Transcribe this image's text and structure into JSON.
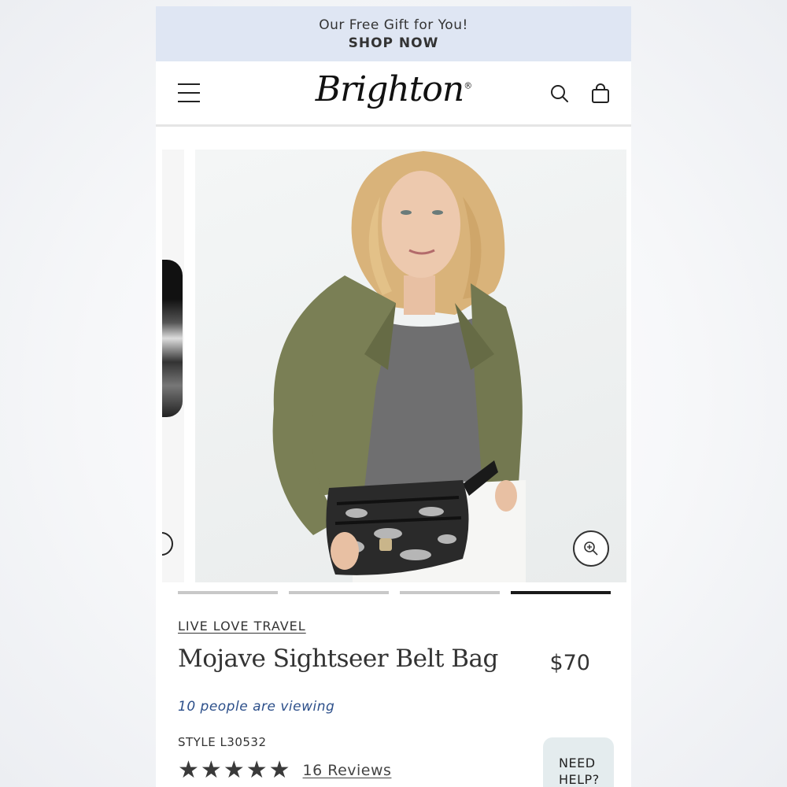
{
  "promo": {
    "text": "Our Free Gift for You!",
    "cta": "SHOP NOW"
  },
  "header": {
    "logo": "Brighton"
  },
  "gallery": {
    "slide_count": 4,
    "active_slide": 4
  },
  "product": {
    "collection": "LIVE LOVE TRAVEL",
    "title": "Mojave Sightseer Belt Bag",
    "price": "$70",
    "viewing": "10 people are viewing",
    "style": "STYLE L30532",
    "rating": 5,
    "reviews": "16 Reviews"
  },
  "help": {
    "line1": "NEED",
    "line2": "HELP?"
  }
}
